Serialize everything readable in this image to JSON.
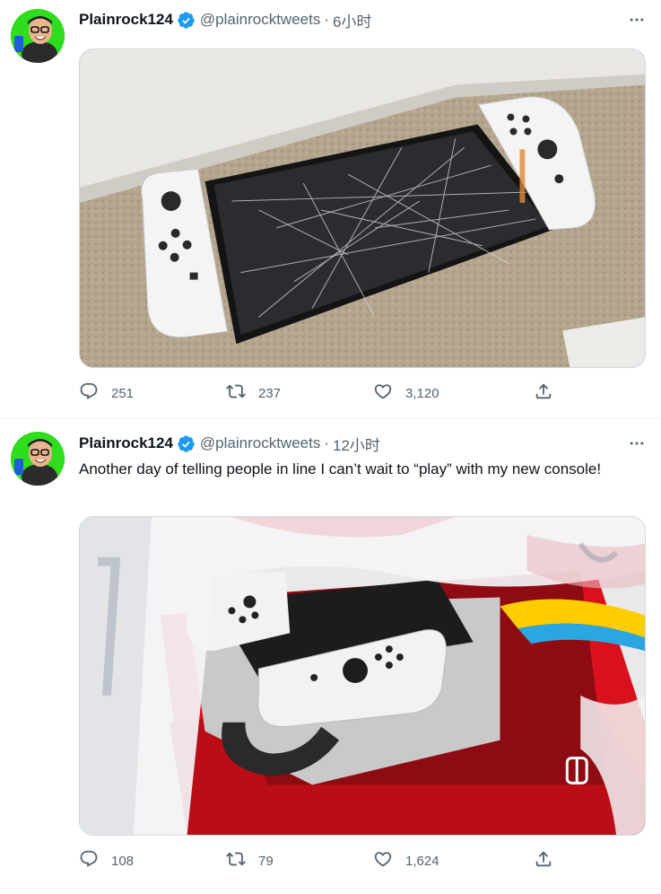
{
  "tweets": [
    {
      "user": {
        "name": "Plainrock124",
        "handle": "@plainrocktweets"
      },
      "time": "6小时",
      "separator": "·",
      "text": "",
      "stats": {
        "replies": "251",
        "retweets": "237",
        "likes": "3,120"
      }
    },
    {
      "user": {
        "name": "Plainrock124",
        "handle": "@plainrocktweets"
      },
      "time": "12小时",
      "separator": "·",
      "text": "Another day of telling people in line I can’t wait to “play” with my new console!",
      "stats": {
        "replies": "108",
        "retweets": "79",
        "likes": "1,624"
      }
    }
  ],
  "colors": {
    "verified": "#1d9bf0",
    "secondary": "#536471",
    "avatar_bg": "#2fdc1e",
    "switch_red": "#e60012"
  },
  "icons": [
    "verified-badge-icon",
    "more-icon",
    "reply-icon",
    "retweet-icon",
    "like-icon",
    "share-icon"
  ]
}
